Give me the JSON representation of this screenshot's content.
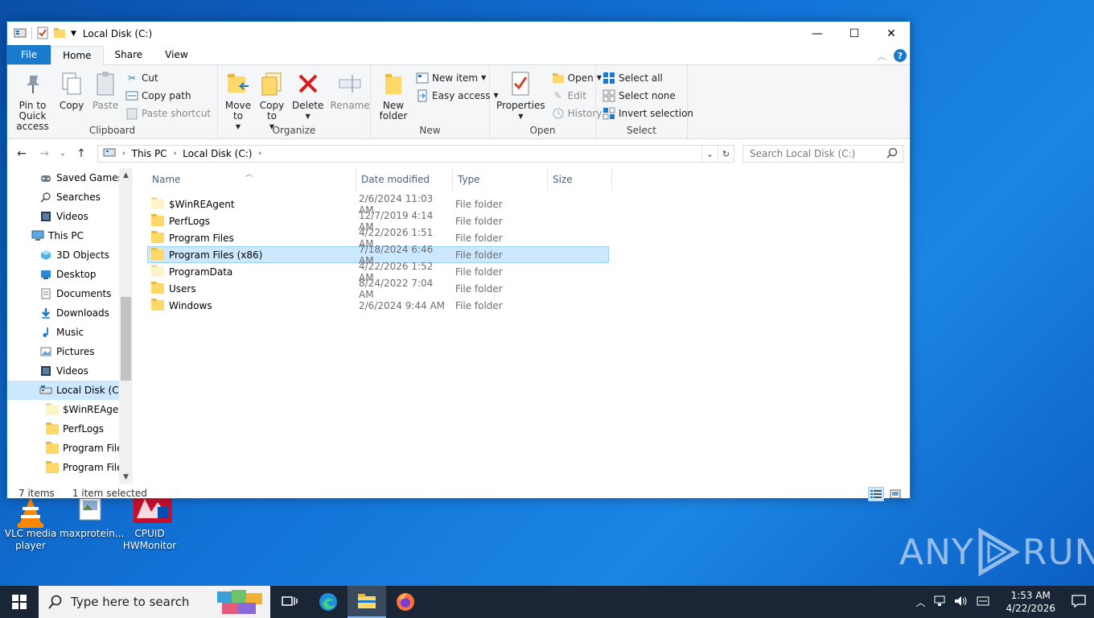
{
  "window": {
    "title": "Local Disk (C:)",
    "controls": {
      "minimize": "—",
      "maximize": "☐",
      "close": "✕"
    }
  },
  "ribbon_tabs": [
    "File",
    "Home",
    "Share",
    "View"
  ],
  "ribbon": {
    "clipboard": {
      "title": "Clipboard",
      "pin": "Pin to Quick access",
      "copy": "Copy",
      "paste": "Paste",
      "cut": "Cut",
      "copy_path": "Copy path",
      "paste_shortcut": "Paste shortcut"
    },
    "organize": {
      "title": "Organize",
      "move_to": "Move to",
      "copy_to": "Copy to",
      "delete": "Delete",
      "rename": "Rename"
    },
    "new": {
      "title": "New",
      "new_folder": "New folder",
      "new_item": "New item",
      "easy_access": "Easy access"
    },
    "open": {
      "title": "Open",
      "properties": "Properties",
      "open": "Open",
      "edit": "Edit",
      "history": "History"
    },
    "select": {
      "title": "Select",
      "select_all": "Select all",
      "select_none": "Select none",
      "invert": "Invert selection"
    }
  },
  "address": {
    "crumbs": [
      "This PC",
      "Local Disk (C:)"
    ],
    "search_placeholder": "Search Local Disk (C:)"
  },
  "nav_pane": [
    {
      "label": "Saved Games",
      "icon": "saved-games-icon",
      "indent": 1
    },
    {
      "label": "Searches",
      "icon": "searches-icon",
      "indent": 1
    },
    {
      "label": "Videos",
      "icon": "videos-icon",
      "indent": 1
    },
    {
      "label": "This PC",
      "icon": "this-pc-icon",
      "indent": 0
    },
    {
      "label": "3D Objects",
      "icon": "3d-objects-icon",
      "indent": 1
    },
    {
      "label": "Desktop",
      "icon": "desktop-icon",
      "indent": 1
    },
    {
      "label": "Documents",
      "icon": "documents-icon",
      "indent": 1
    },
    {
      "label": "Downloads",
      "icon": "downloads-icon",
      "indent": 1
    },
    {
      "label": "Music",
      "icon": "music-icon",
      "indent": 1
    },
    {
      "label": "Pictures",
      "icon": "pictures-icon",
      "indent": 1
    },
    {
      "label": "Videos",
      "icon": "videos-icon",
      "indent": 1
    },
    {
      "label": "Local Disk (C:)",
      "icon": "drive-icon",
      "indent": 1,
      "selected": true
    },
    {
      "label": "$WinREAgent",
      "icon": "folder-icon",
      "indent": 2
    },
    {
      "label": "PerfLogs",
      "icon": "folder-icon",
      "indent": 2
    },
    {
      "label": "Program Files",
      "icon": "folder-icon",
      "indent": 2
    },
    {
      "label": "Program Files",
      "icon": "folder-icon",
      "indent": 2
    }
  ],
  "columns": {
    "name": "Name",
    "date": "Date modified",
    "type": "Type",
    "size": "Size"
  },
  "files": [
    {
      "name": "$WinREAgent",
      "date": "2/6/2024 11:03 AM",
      "type": "File folder",
      "pale": true
    },
    {
      "name": "PerfLogs",
      "date": "12/7/2019 4:14 AM",
      "type": "File folder"
    },
    {
      "name": "Program Files",
      "date": "4/22/2026 1:51 AM",
      "type": "File folder"
    },
    {
      "name": "Program Files (x86)",
      "date": "7/18/2024 6:46 AM",
      "type": "File folder",
      "selected": true
    },
    {
      "name": "ProgramData",
      "date": "4/22/2026 1:52 AM",
      "type": "File folder",
      "pale": true
    },
    {
      "name": "Users",
      "date": "8/24/2022 7:04 AM",
      "type": "File folder"
    },
    {
      "name": "Windows",
      "date": "2/6/2024 9:44 AM",
      "type": "File folder"
    }
  ],
  "status": {
    "count": "7 items",
    "selected": "1 item selected"
  },
  "desktop_icons": [
    {
      "label": "VLC media player"
    },
    {
      "label": "maxprotein..."
    },
    {
      "label": "CPUID HWMonitor"
    }
  ],
  "watermark": {
    "left": "ANY",
    "right": "RUN"
  },
  "taskbar": {
    "search_placeholder": "Type here to search",
    "time": "1:53 AM",
    "date": "4/22/2026"
  },
  "colors": {
    "accent": "#1979ca",
    "selection": "#cce8ff",
    "folder": "#ffd867"
  }
}
